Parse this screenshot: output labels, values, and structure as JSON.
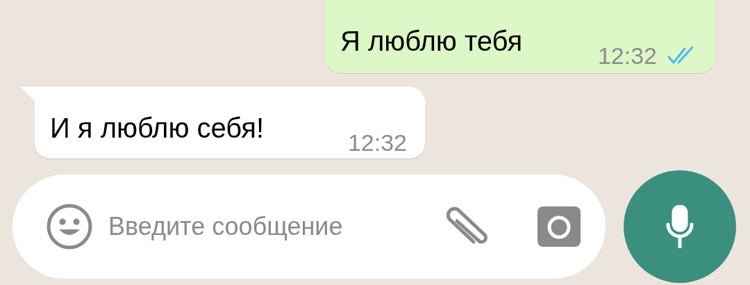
{
  "messages": [
    {
      "kind": "outgoing",
      "text": "Я люблю тебя",
      "time": "12:32",
      "read": true
    },
    {
      "kind": "incoming",
      "text": "И я люблю себя!",
      "time": "12:32"
    }
  ],
  "composer": {
    "placeholder": "Введите сообщение"
  }
}
